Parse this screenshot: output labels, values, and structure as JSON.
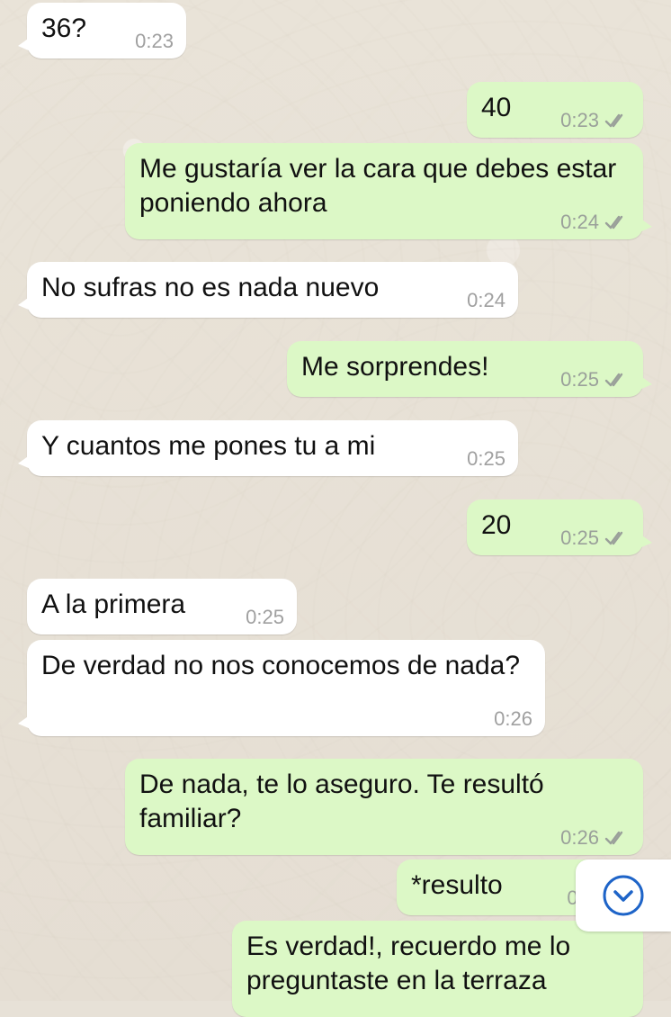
{
  "chat": {
    "messages": [
      {
        "direction": "incoming",
        "text": "36?",
        "time": "0:23",
        "read": false
      },
      {
        "direction": "outgoing",
        "text": "40",
        "time": "0:23",
        "read": true
      },
      {
        "direction": "outgoing",
        "text": "Me gustaría ver la cara que debes estar poniendo ahora",
        "time": "0:24",
        "read": true
      },
      {
        "direction": "incoming",
        "text": "No sufras no es nada nuevo",
        "time": "0:24",
        "read": false
      },
      {
        "direction": "outgoing",
        "text": "Me sorprendes!",
        "time": "0:25",
        "read": true
      },
      {
        "direction": "incoming",
        "text": "Y cuantos me pones tu a mi",
        "time": "0:25",
        "read": false
      },
      {
        "direction": "outgoing",
        "text": "20",
        "time": "0:25",
        "read": true
      },
      {
        "direction": "incoming",
        "text": "A la primera",
        "time": "0:25",
        "read": false
      },
      {
        "direction": "incoming",
        "text": "De verdad no nos conocemos de nada?",
        "time": "0:26",
        "read": false
      },
      {
        "direction": "outgoing",
        "text": "De nada, te lo aseguro. Te resultó familiar?",
        "time": "0:26",
        "read": true
      },
      {
        "direction": "outgoing",
        "text": "*resulto",
        "time": "0:2",
        "read": true
      },
      {
        "direction": "outgoing",
        "text": "Es verdad!, recuerdo me lo preguntaste en la terraza",
        "time": "",
        "read": false
      }
    ]
  },
  "controls": {
    "scroll_down_icon": "chevron-down-circle-icon"
  },
  "colors": {
    "wallpaper": "#e7e1d7",
    "incoming_bubble": "#ffffff",
    "outgoing_bubble": "#dcf8c6",
    "read_ticks": "#9aa09a",
    "scroll_icon": "#1e64c8"
  }
}
